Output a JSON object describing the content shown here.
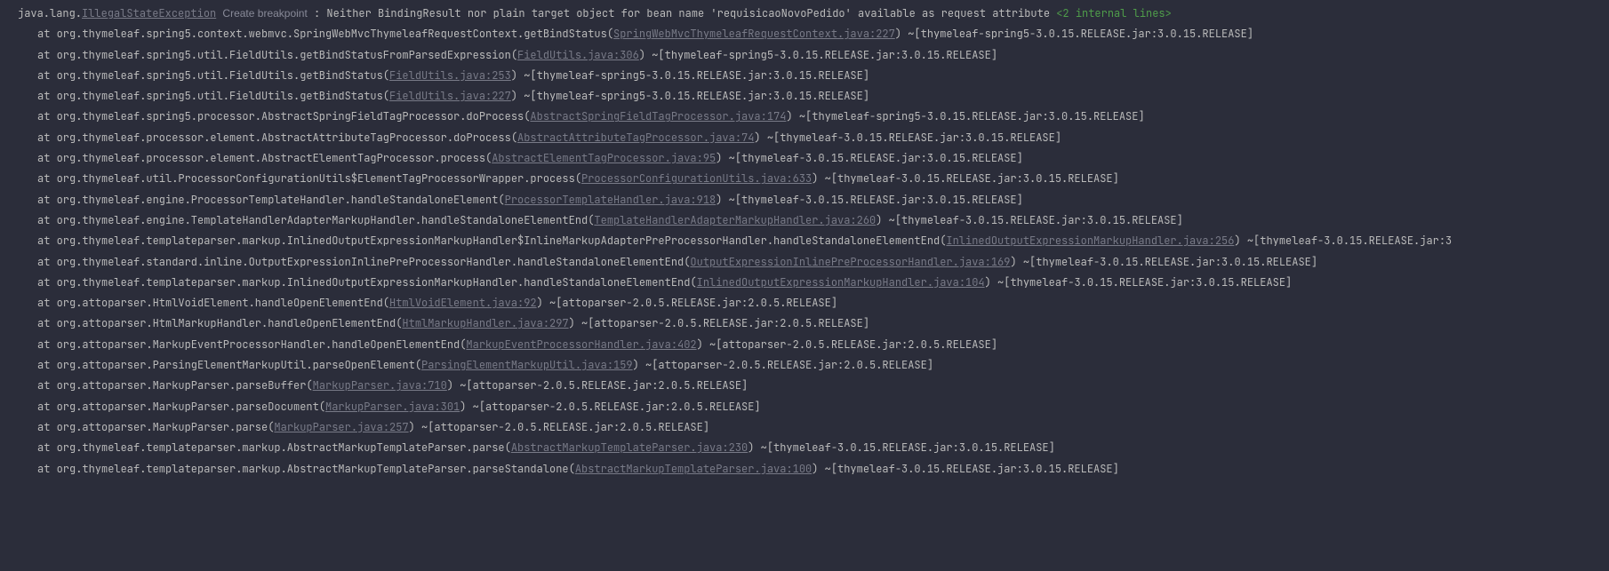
{
  "header": {
    "prefix": "java.lang.",
    "exception_class": "IllegalStateException",
    "breakpoint_label": "Create breakpoint",
    "message": ": Neither BindingResult nor plain target object for bean name 'requisicaoNovoPedido' available as request attribute ",
    "internal_lines": "<2 internal lines>"
  },
  "frames": [
    {
      "at": "at ",
      "method": "org.thymeleaf.spring5.context.webmvc.SpringWebMvcThymeleafRequestContext.getBindStatus(",
      "link": "SpringWebMvcThymeleafRequestContext.java:227",
      "tail": ") ~[thymeleaf-spring5-3.0.15.RELEASE.jar:3.0.15.RELEASE]"
    },
    {
      "at": "at ",
      "method": "org.thymeleaf.spring5.util.FieldUtils.getBindStatusFromParsedExpression(",
      "link": "FieldUtils.java:306",
      "tail": ") ~[thymeleaf-spring5-3.0.15.RELEASE.jar:3.0.15.RELEASE]"
    },
    {
      "at": "at ",
      "method": "org.thymeleaf.spring5.util.FieldUtils.getBindStatus(",
      "link": "FieldUtils.java:253",
      "tail": ") ~[thymeleaf-spring5-3.0.15.RELEASE.jar:3.0.15.RELEASE]"
    },
    {
      "at": "at ",
      "method": "org.thymeleaf.spring5.util.FieldUtils.getBindStatus(",
      "link": "FieldUtils.java:227",
      "tail": ") ~[thymeleaf-spring5-3.0.15.RELEASE.jar:3.0.15.RELEASE]"
    },
    {
      "at": "at ",
      "method": "org.thymeleaf.spring5.processor.AbstractSpringFieldTagProcessor.doProcess(",
      "link": "AbstractSpringFieldTagProcessor.java:174",
      "tail": ") ~[thymeleaf-spring5-3.0.15.RELEASE.jar:3.0.15.RELEASE]"
    },
    {
      "at": "at ",
      "method": "org.thymeleaf.processor.element.AbstractAttributeTagProcessor.doProcess(",
      "link": "AbstractAttributeTagProcessor.java:74",
      "tail": ") ~[thymeleaf-3.0.15.RELEASE.jar:3.0.15.RELEASE]"
    },
    {
      "at": "at ",
      "method": "org.thymeleaf.processor.element.AbstractElementTagProcessor.process(",
      "link": "AbstractElementTagProcessor.java:95",
      "tail": ") ~[thymeleaf-3.0.15.RELEASE.jar:3.0.15.RELEASE]"
    },
    {
      "at": "at ",
      "method": "org.thymeleaf.util.ProcessorConfigurationUtils$ElementTagProcessorWrapper.process(",
      "link": "ProcessorConfigurationUtils.java:633",
      "tail": ") ~[thymeleaf-3.0.15.RELEASE.jar:3.0.15.RELEASE]"
    },
    {
      "at": "at ",
      "method": "org.thymeleaf.engine.ProcessorTemplateHandler.handleStandaloneElement(",
      "link": "ProcessorTemplateHandler.java:918",
      "tail": ") ~[thymeleaf-3.0.15.RELEASE.jar:3.0.15.RELEASE]"
    },
    {
      "at": "at ",
      "method": "org.thymeleaf.engine.TemplateHandlerAdapterMarkupHandler.handleStandaloneElementEnd(",
      "link": "TemplateHandlerAdapterMarkupHandler.java:260",
      "tail": ") ~[thymeleaf-3.0.15.RELEASE.jar:3.0.15.RELEASE]"
    },
    {
      "at": "at ",
      "method": "org.thymeleaf.templateparser.markup.InlinedOutputExpressionMarkupHandler$InlineMarkupAdapterPreProcessorHandler.handleStandaloneElementEnd(",
      "link": "InlinedOutputExpressionMarkupHandler.java:256",
      "tail": ") ~[thymeleaf-3.0.15.RELEASE.jar:3"
    },
    {
      "at": "at ",
      "method": "org.thymeleaf.standard.inline.OutputExpressionInlinePreProcessorHandler.handleStandaloneElementEnd(",
      "link": "OutputExpressionInlinePreProcessorHandler.java:169",
      "tail": ") ~[thymeleaf-3.0.15.RELEASE.jar:3.0.15.RELEASE]"
    },
    {
      "at": "at ",
      "method": "org.thymeleaf.templateparser.markup.InlinedOutputExpressionMarkupHandler.handleStandaloneElementEnd(",
      "link": "InlinedOutputExpressionMarkupHandler.java:104",
      "tail": ") ~[thymeleaf-3.0.15.RELEASE.jar:3.0.15.RELEASE]"
    },
    {
      "at": "at ",
      "method": "org.attoparser.HtmlVoidElement.handleOpenElementEnd(",
      "link": "HtmlVoidElement.java:92",
      "tail": ") ~[attoparser-2.0.5.RELEASE.jar:2.0.5.RELEASE]"
    },
    {
      "at": "at ",
      "method": "org.attoparser.HtmlMarkupHandler.handleOpenElementEnd(",
      "link": "HtmlMarkupHandler.java:297",
      "tail": ") ~[attoparser-2.0.5.RELEASE.jar:2.0.5.RELEASE]"
    },
    {
      "at": "at ",
      "method": "org.attoparser.MarkupEventProcessorHandler.handleOpenElementEnd(",
      "link": "MarkupEventProcessorHandler.java:402",
      "tail": ") ~[attoparser-2.0.5.RELEASE.jar:2.0.5.RELEASE]"
    },
    {
      "at": "at ",
      "method": "org.attoparser.ParsingElementMarkupUtil.parseOpenElement(",
      "link": "ParsingElementMarkupUtil.java:159",
      "tail": ") ~[attoparser-2.0.5.RELEASE.jar:2.0.5.RELEASE]"
    },
    {
      "at": "at ",
      "method": "org.attoparser.MarkupParser.parseBuffer(",
      "link": "MarkupParser.java:710",
      "tail": ") ~[attoparser-2.0.5.RELEASE.jar:2.0.5.RELEASE]"
    },
    {
      "at": "at ",
      "method": "org.attoparser.MarkupParser.parseDocument(",
      "link": "MarkupParser.java:301",
      "tail": ") ~[attoparser-2.0.5.RELEASE.jar:2.0.5.RELEASE]"
    },
    {
      "at": "at ",
      "method": "org.attoparser.MarkupParser.parse(",
      "link": "MarkupParser.java:257",
      "tail": ") ~[attoparser-2.0.5.RELEASE.jar:2.0.5.RELEASE]"
    },
    {
      "at": "at ",
      "method": "org.thymeleaf.templateparser.markup.AbstractMarkupTemplateParser.parse(",
      "link": "AbstractMarkupTemplateParser.java:230",
      "tail": ") ~[thymeleaf-3.0.15.RELEASE.jar:3.0.15.RELEASE]"
    },
    {
      "at": "at ",
      "method": "org.thymeleaf.templateparser.markup.AbstractMarkupTemplateParser.parseStandalone(",
      "link": "AbstractMarkupTemplateParser.java:100",
      "tail": ") ~[thymeleaf-3.0.15.RELEASE.jar:3.0.15.RELEASE]"
    }
  ]
}
